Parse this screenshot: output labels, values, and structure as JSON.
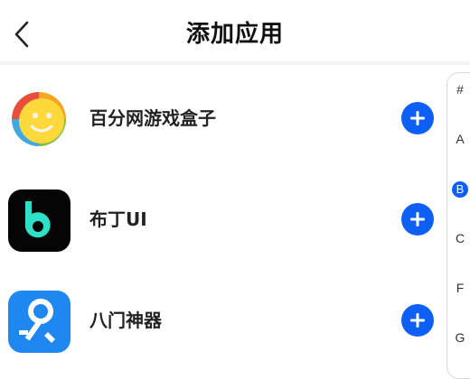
{
  "header": {
    "title": "添加应用",
    "back_icon": "chevron-left-icon"
  },
  "apps": [
    {
      "name": "百分网游戏盒子",
      "icon": "baifen-game-box-icon",
      "action_icon": "plus-icon"
    },
    {
      "name": "布丁UI",
      "icon": "buding-ui-icon",
      "action_icon": "plus-icon"
    },
    {
      "name": "八门神器",
      "icon": "bamen-tool-icon",
      "action_icon": "plus-icon"
    }
  ],
  "index_bar": {
    "letters": [
      "#",
      "A",
      "B",
      "C",
      "F",
      "G"
    ],
    "active": "B"
  },
  "colors": {
    "accent": "#0d5ff5",
    "divider": "#f4f4f4"
  }
}
